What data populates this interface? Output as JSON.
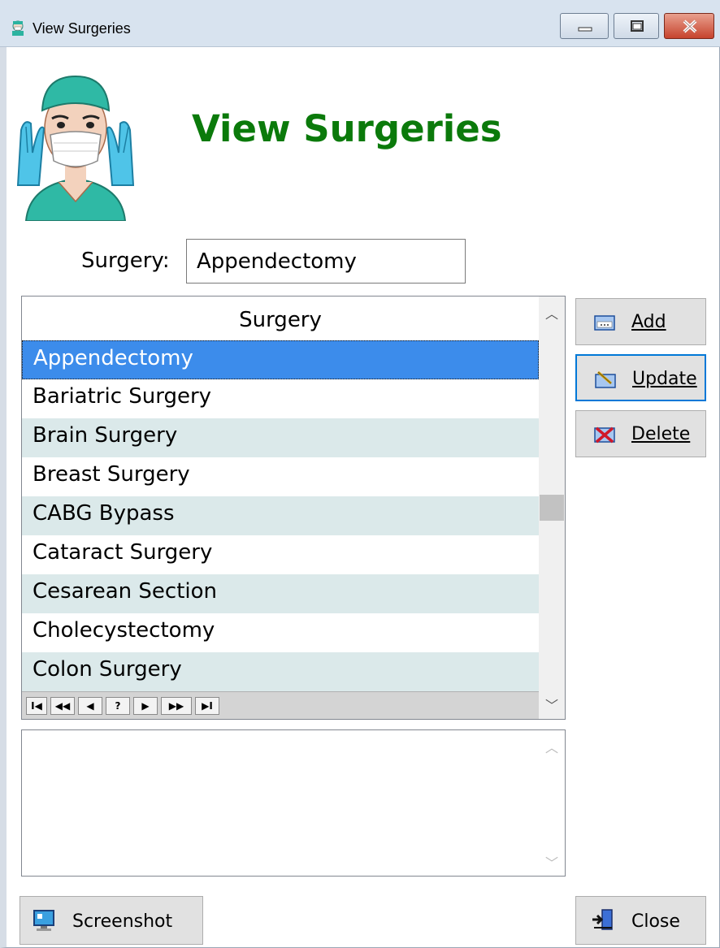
{
  "window": {
    "title": "View Surgeries"
  },
  "heading": "View Surgeries",
  "filter": {
    "label": "Surgery:",
    "value": "Appendectomy"
  },
  "grid": {
    "column_header": "Surgery",
    "rows": [
      {
        "name": "Appendectomy",
        "selected": true
      },
      {
        "name": "Bariatric Surgery"
      },
      {
        "name": "Brain Surgery"
      },
      {
        "name": "Breast Surgery"
      },
      {
        "name": "CABG Bypass"
      },
      {
        "name": "Cataract Surgery"
      },
      {
        "name": "Cesarean Section"
      },
      {
        "name": "Cholecystectomy"
      },
      {
        "name": "Colon Surgery"
      }
    ],
    "nav_buttons": [
      "I◀",
      "◀◀",
      "◀",
      "?",
      "▶",
      "▶▶",
      "▶I"
    ]
  },
  "buttons": {
    "add": "Add",
    "update": "Update",
    "delete": "Delete",
    "screenshot": "Screenshot",
    "close": "Close"
  },
  "colors": {
    "heading": "#0b7a0b",
    "selection": "#3c8ceb",
    "alt_row": "#dbe9ea"
  }
}
